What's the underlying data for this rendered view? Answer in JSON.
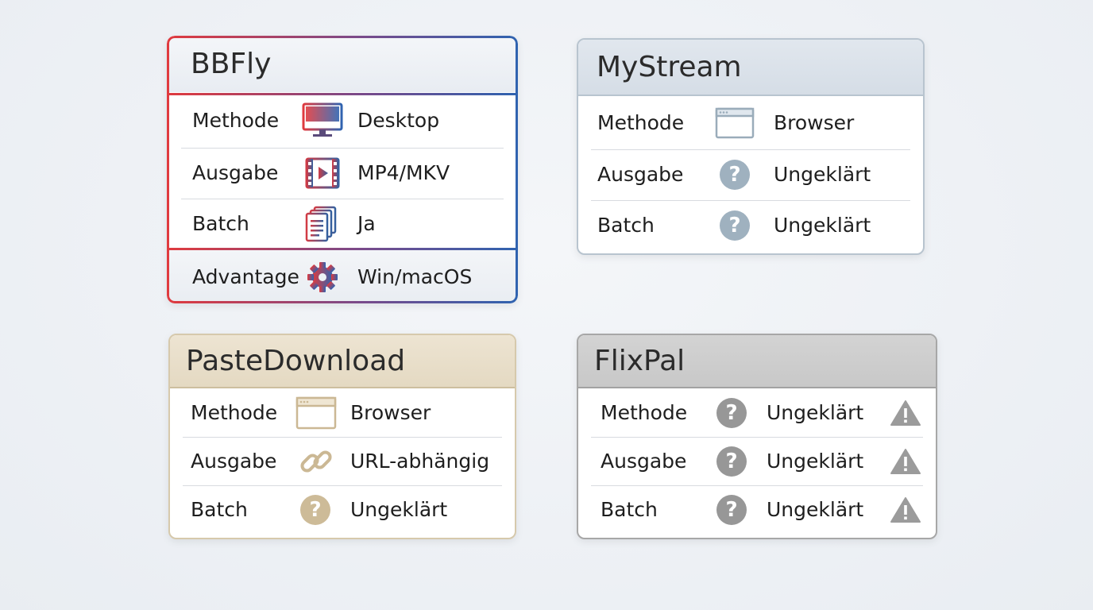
{
  "cards": [
    {
      "title": "BBFly",
      "rows": [
        {
          "label": "Methode",
          "icon": "desktop-monitor-icon",
          "value": "Desktop"
        },
        {
          "label": "Ausgabe",
          "icon": "video-film-icon",
          "value": "MP4/MKV"
        },
        {
          "label": "Batch",
          "icon": "documents-stack-icon",
          "value": "Ja"
        },
        {
          "label": "Advantage",
          "icon": "gear-icon",
          "value": "Win/macOS"
        }
      ],
      "colors": {
        "border_start": "#e03a3e",
        "border_end": "#2f63b0"
      }
    },
    {
      "title": "MyStream",
      "rows": [
        {
          "label": "Methode",
          "icon": "browser-window-icon",
          "value": "Browser"
        },
        {
          "label": "Ausgabe",
          "icon": "question-circle-icon",
          "value": "Ungeklärt"
        },
        {
          "label": "Batch",
          "icon": "question-circle-icon",
          "value": "Ungeklärt"
        }
      ],
      "colors": {
        "border": "#b8c4cf",
        "icon": "#9aacba"
      }
    },
    {
      "title": "PasteDownload",
      "rows": [
        {
          "label": "Methode",
          "icon": "browser-window-icon",
          "value": "Browser"
        },
        {
          "label": "Ausgabe",
          "icon": "link-chain-icon",
          "value": "URL-abhängig"
        },
        {
          "label": "Batch",
          "icon": "question-circle-icon",
          "value": "Ungeklärt"
        }
      ],
      "colors": {
        "border": "#d6c9ac",
        "icon": "#cbb894"
      }
    },
    {
      "title": "FlixPal",
      "rows": [
        {
          "label": "Methode",
          "icon": "question-circle-icon",
          "value": "Ungeklärt",
          "flag": "warning-triangle-icon"
        },
        {
          "label": "Ausgabe",
          "icon": "question-circle-icon",
          "value": "Ungeklärt",
          "flag": "warning-triangle-icon"
        },
        {
          "label": "Batch",
          "icon": "question-circle-icon",
          "value": "Ungeklärt",
          "flag": "warning-triangle-icon"
        }
      ],
      "colors": {
        "border": "#a7a7a7",
        "icon": "#9a9a9a"
      }
    }
  ]
}
